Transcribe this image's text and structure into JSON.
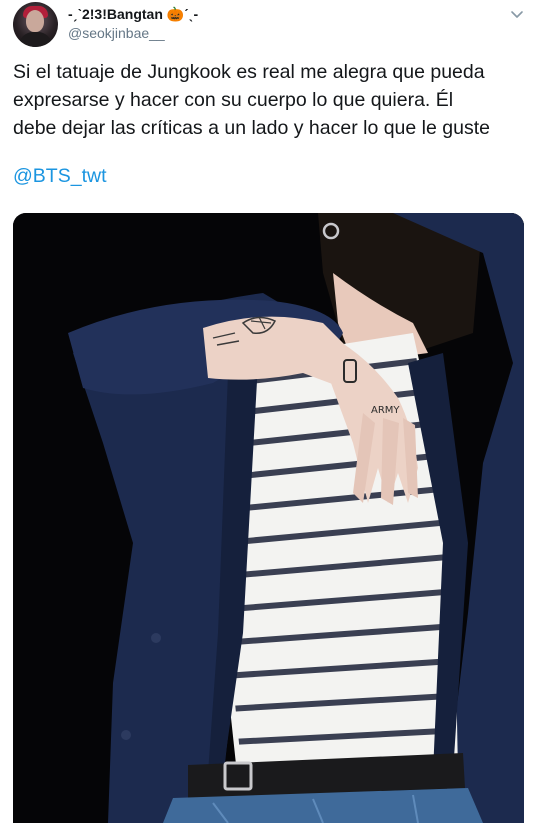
{
  "user": {
    "display_name": "-ˏˋ2!3!Bangtan 🎃ˊˎ-",
    "handle": "@seokjinbae__"
  },
  "tweet": {
    "lines": [
      "Si el tatuaje de Jungkook es real me alegra que pueda",
      "expresarse y hacer con su cuerpo lo que quiera. Él",
      "debe dejar las críticas a un lado y hacer lo que le guste"
    ],
    "mention": "@BTS_twt"
  },
  "media": {
    "tattoo_text": "ARMY",
    "colors": {
      "background": "#050507",
      "jacket": "#1c2a4e",
      "skin": "#ecd2c6",
      "stripe": "#3a3f52",
      "denim": "#3f6a9a",
      "link": "#1b95e0"
    }
  },
  "icons": {
    "menu": "chevron-down-icon"
  }
}
